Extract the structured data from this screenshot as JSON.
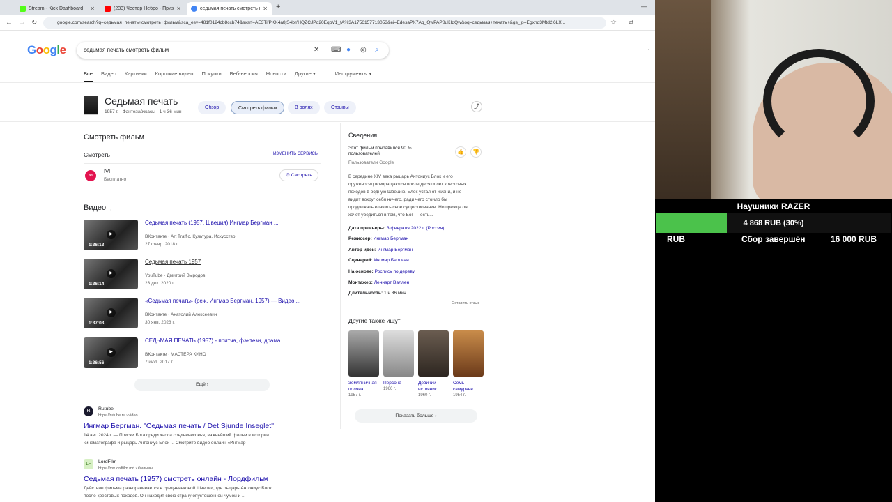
{
  "tabs": [
    {
      "title": "Stream - Kick Dashboard",
      "color": "#53fc18"
    },
    {
      "title": "(233) Честер Небро - Призна...",
      "color": "#ff0000"
    },
    {
      "title": "седьмая печать смотреть фил...",
      "color": "#4285f4"
    }
  ],
  "url": "google.com/search?q=седьмая+печать+смотреть+фильм&sca_esv=481f0124cb8ccb74&sxsrf=AE3TifPKX4a8jS4bYHQZCJPo20EqbV1_tA%3A1756157713053&ei=EdesaPX7Aq_QwPAP8uKIqQw&oq=седьмая+печать+&gs_lp=Egxnd3Mtd2l6LX...",
  "search": {
    "logo": "Google",
    "query": "седьмая печать смотреть фильм",
    "nav": [
      "Все",
      "Видео",
      "Картинки",
      "Короткие видео",
      "Покупки",
      "Веб-версия",
      "Новости",
      "Другие ▾",
      "Инструменты ▾"
    ]
  },
  "film": {
    "title": "Седьмая печать",
    "subtitle": "1957 г. · Фэнтези/Ужасы · 1 ч 36 мин",
    "pills": [
      "Обзор",
      "Смотреть фильм",
      "В ролях",
      "Отзывы"
    ]
  },
  "watch": {
    "heading": "Смотреть фильм",
    "sub": "Смотреть",
    "change": "ИЗМЕНИТЬ СЕРВИСЫ",
    "service": "IVI",
    "price": "Бесплатно",
    "btn": "Смотреть"
  },
  "videos": {
    "heading": "Видео",
    "more": "Ещё",
    "items": [
      {
        "title": "Седьмая печать (1957, Швеция) Ингмар Бергман ...",
        "meta": "ВКонтакте · Art Traffic. Культура. Искусство",
        "date": "27 февр. 2018 г.",
        "dur": "1:36:13"
      },
      {
        "title": "Седьмая печать 1957",
        "meta": "YouTube · Дмитрий Выродов",
        "date": "23 дек. 2020 г.",
        "dur": "1:36:14"
      },
      {
        "title": "«Седьмая печать» (реж. Ингмар Бергман, 1957) — Видео ...",
        "meta": "ВКонтакте · Анатолий Алексеевич",
        "date": "30 янв. 2023 г.",
        "dur": "1:37:03"
      },
      {
        "title": "СЕДЬМАЯ ПЕЧАТЬ (1957) - притча, фэнтези, драма ...",
        "meta": "ВКонтакте · МАСТЕРА КИНО",
        "date": "7 июл. 2017 г.",
        "dur": "1:36:56"
      }
    ]
  },
  "results": [
    {
      "site": "Rutube",
      "url": "https://rutube.ru › video",
      "title": "Ингмар Бергман. \"Седьмая печать / Det Sjunde Inseglet\"",
      "snippet1": "14 авг. 2024 г. — Поиски Бога среди хаоса средневековья, важнейший фильм в истории",
      "snippet2": "кинематографа и рыцарь Антониус Блок ... Смотрите видео онлайн «Ингмар"
    },
    {
      "site": "LordFilm",
      "url": "https://mv.lordfilm.md › Фильмы",
      "title": "Седьмая печать (1957) смотреть онлайн - Лордфильм",
      "snippet1": "Действие фильма разворачивается в средневековой Швеции, где рыцарь Антониус Блок",
      "snippet2": "после крестовых походов. Он находит свою страну опустошенной чумой и ..."
    }
  ],
  "info": {
    "heading": "Сведения",
    "liked": "Этот фильм понравился 90 % пользователей",
    "liked_src": "Пользователи Google",
    "desc": [
      "В середине XIV века рыцарь Антониус Блок и его",
      "оруженосец возвращаются после десяти лет крестовых",
      "походов в родную Швецию. Блок устал от жизни, и не",
      "видит вокруг себя ничего, ради чего стоило бы",
      "продолжать влачить свое существование. Но прежде он",
      "хочет убедиться в том, что Бог — есть..."
    ],
    "facts": [
      {
        "k": "Дата премьеры:",
        "v": "3 февраля 2022 г. (Россия)"
      },
      {
        "k": "Режиссер:",
        "v": "Ингмар Бергман"
      },
      {
        "k": "Автор идеи:",
        "v": "Ингмар Бергман"
      },
      {
        "k": "Сценарий:",
        "v": "Ингмар Бергман"
      },
      {
        "k": "На основе:",
        "v": "Роспись по дереву"
      },
      {
        "k": "Монтажер:",
        "v": "Леннарт Валлен"
      },
      {
        "k": "Длительность:",
        "v": "1 ч 36 мин"
      }
    ],
    "feedback": "Оставить отзыв",
    "also_heading": "Другие также ищут",
    "also": [
      {
        "name": "Земляничная поляна",
        "year": "1957 г."
      },
      {
        "name": "Персона",
        "year": "1966 г."
      },
      {
        "name": "Девичий источник",
        "year": "1960 г."
      },
      {
        "name": "Семь самураев",
        "year": "1954 г."
      }
    ],
    "show_more": "Показать больше"
  },
  "overlay": {
    "title": "Наушники RAZER",
    "progress_text": "4 868 RUB (30%)",
    "progress_fraction": 0.3,
    "currency": "RUB",
    "status": "Сбор завершён",
    "goal": "16 000 RUB"
  }
}
